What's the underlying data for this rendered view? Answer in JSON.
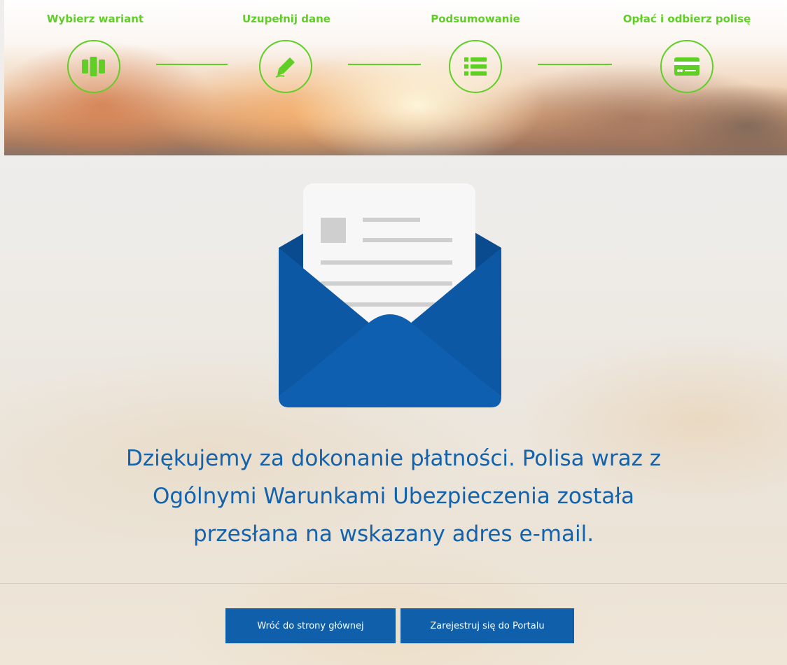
{
  "stepper": {
    "steps": [
      {
        "label": "Wybierz wariant",
        "icon": "columns-icon"
      },
      {
        "label": "Uzupełnij dane",
        "icon": "pencil-icon"
      },
      {
        "label": "Podsumowanie",
        "icon": "list-icon"
      },
      {
        "label": "Opłać i odbierz polisę",
        "icon": "credit-card-icon"
      }
    ],
    "accent_color": "#5fcf25"
  },
  "illustration": {
    "icon": "open-envelope-letter-icon",
    "envelope_color": "#0d5ba8",
    "letter_color": "#f7f7f7"
  },
  "message": {
    "line1": "Dziękujemy za dokonanie płatności. Polisa wraz z",
    "line2": "Ogólnymi Warunkami Ubezpieczenia została",
    "line3": "przesłana na wskazany adres e-mail.",
    "color": "#1262ae"
  },
  "actions": {
    "home_label": "Wróć do strony głównej",
    "register_label": "Zarejestruj się do Portalu",
    "button_color": "#0f5fab"
  }
}
